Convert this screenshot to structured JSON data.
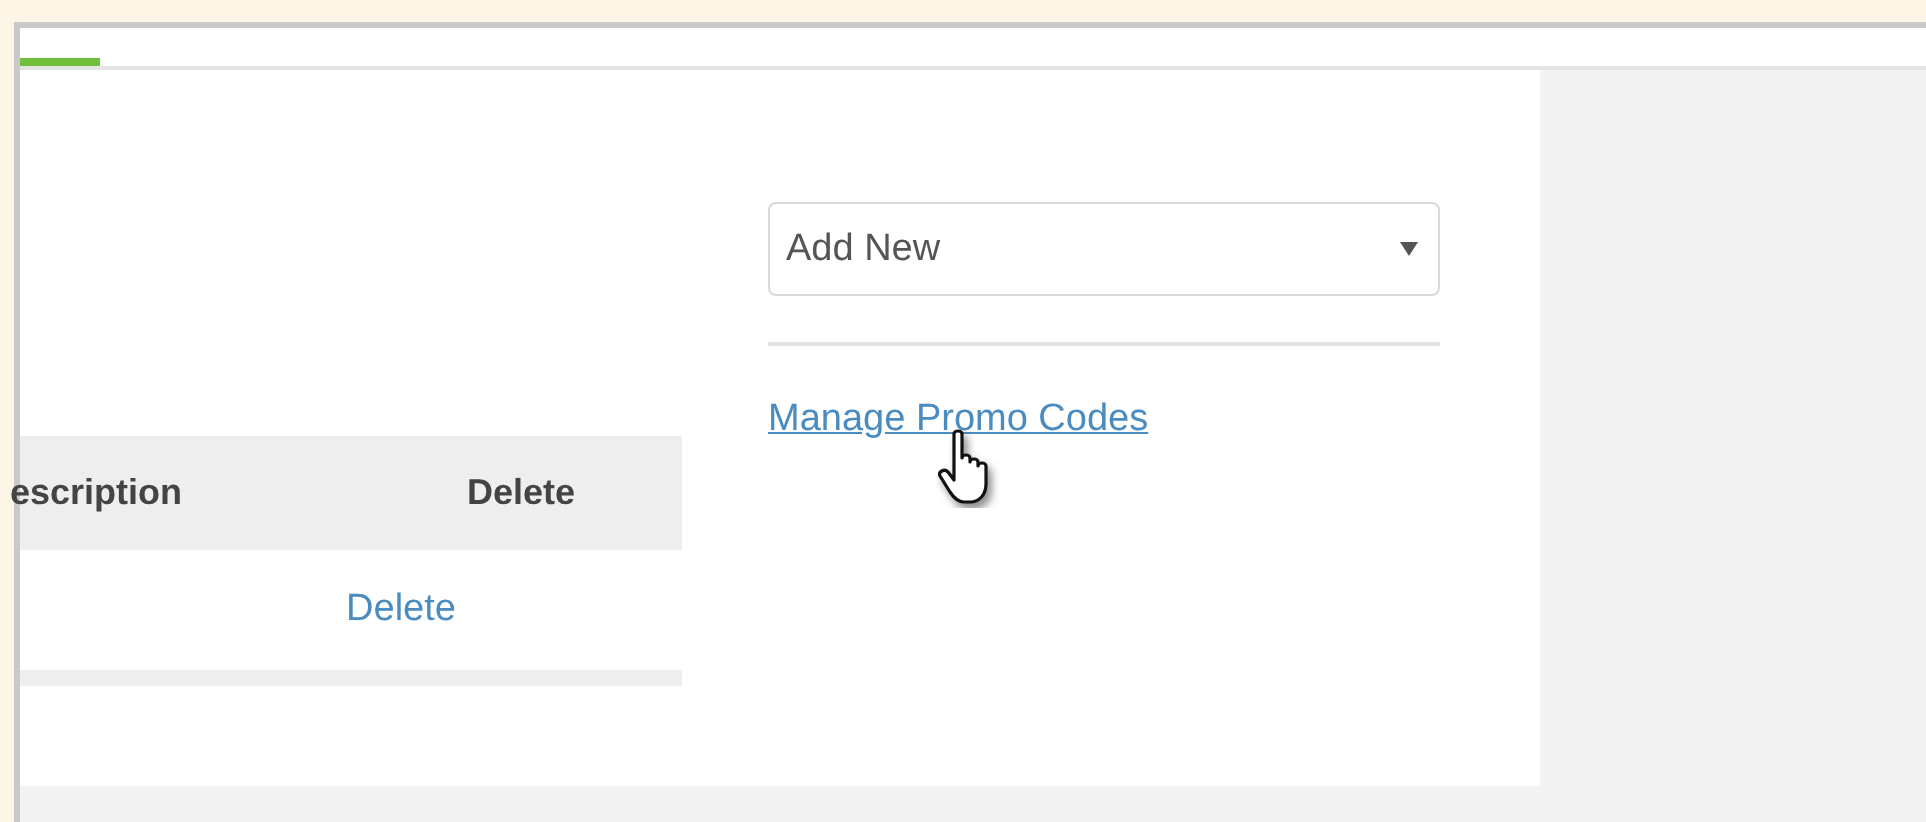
{
  "table": {
    "columns": [
      "escription",
      "Delete"
    ],
    "rows": [
      {
        "cells": [
          "",
          "Delete"
        ]
      }
    ]
  },
  "add_dropdown": {
    "value": "Add New"
  },
  "manage_link": "Manage Promo Codes"
}
